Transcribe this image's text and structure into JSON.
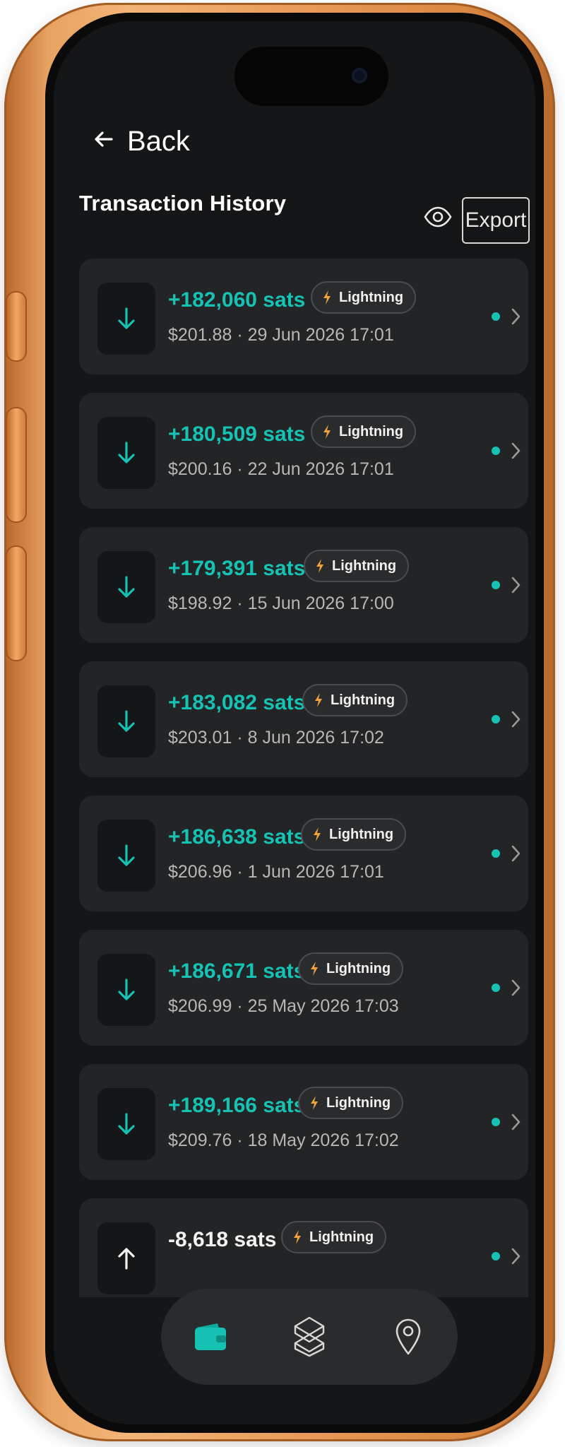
{
  "header": {
    "back_label": "Back",
    "title": "Transaction History",
    "export_label": "Export",
    "visibility_icon": "eye-icon"
  },
  "colors": {
    "accent": "#16c2b4",
    "lightning": "#f3a23a",
    "card_bg": "#232425",
    "screen_bg": "#151617",
    "frame": "#e89a58"
  },
  "transactions": [
    {
      "direction": "in",
      "amount": "+182,060 sats",
      "method": "Lightning",
      "fiat": "$201.88",
      "datetime": "29 Jun 2026 17:01"
    },
    {
      "direction": "in",
      "amount": "+180,509 sats",
      "method": "Lightning",
      "fiat": "$200.16",
      "datetime": "22 Jun 2026 17:01"
    },
    {
      "direction": "in",
      "amount": "+179,391 sats",
      "method": "Lightning",
      "fiat": "$198.92",
      "datetime": "15 Jun 2026 17:00"
    },
    {
      "direction": "in",
      "amount": "+183,082 sats",
      "method": "Lightning",
      "fiat": "$203.01",
      "datetime": "8 Jun 2026 17:02"
    },
    {
      "direction": "in",
      "amount": "+186,638 sats",
      "method": "Lightning",
      "fiat": "$206.96",
      "datetime": "1 Jun 2026 17:01"
    },
    {
      "direction": "in",
      "amount": "+186,671 sats",
      "method": "Lightning",
      "fiat": "$206.99",
      "datetime": "25 May 2026 17:03"
    },
    {
      "direction": "in",
      "amount": "+189,166 sats",
      "method": "Lightning",
      "fiat": "$209.76",
      "datetime": "18 May 2026 17:02"
    },
    {
      "direction": "out",
      "amount": "-8,618 sats",
      "method": "Lightning",
      "fiat": "",
      "datetime": ""
    }
  ],
  "bottom_nav": {
    "items": [
      {
        "icon": "wallet-icon",
        "active": true
      },
      {
        "icon": "layers-icon",
        "active": false
      },
      {
        "icon": "map-pin-icon",
        "active": false
      }
    ]
  }
}
